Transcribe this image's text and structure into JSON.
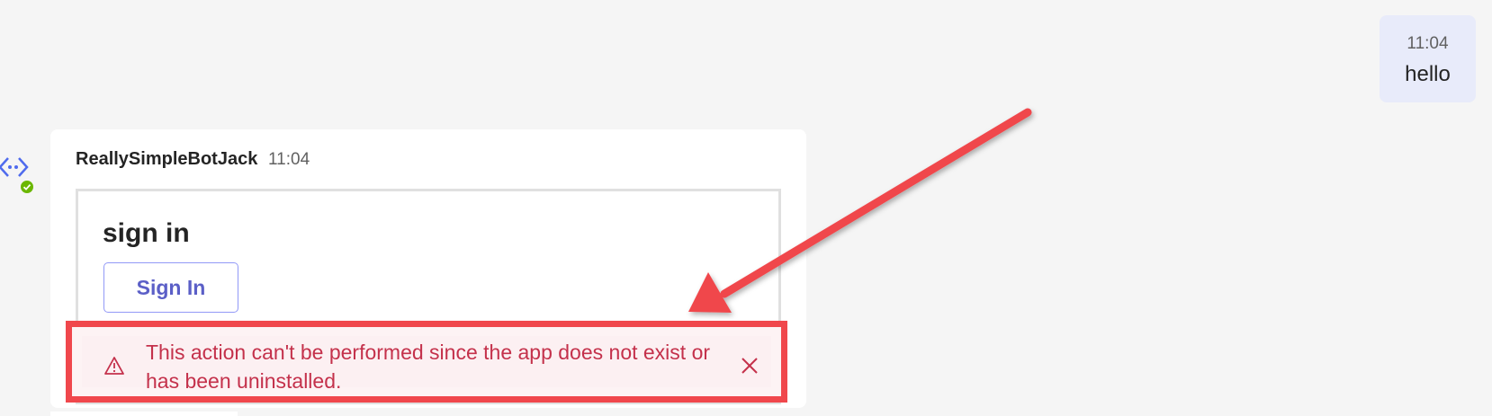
{
  "user_message": {
    "time": "11:04",
    "text": "hello"
  },
  "bot_message": {
    "sender": "ReallySimpleBotJack",
    "time": "11:04",
    "avatar_icon": "bot-icon",
    "presence": "available",
    "card": {
      "title": "sign in",
      "button_label": "Sign In"
    }
  },
  "error_banner": {
    "icon": "warning-icon",
    "text": "This action can't be performed since the app does not exist or has been uninstalled.",
    "dismiss_icon": "close-icon"
  },
  "colors": {
    "background": "#f5f5f5",
    "user_bubble": "#e8ebfa",
    "button_text": "#5b5fc7",
    "error_text": "#c4314b",
    "annotation_red": "#f0474c",
    "presence_green": "#6bb700"
  }
}
